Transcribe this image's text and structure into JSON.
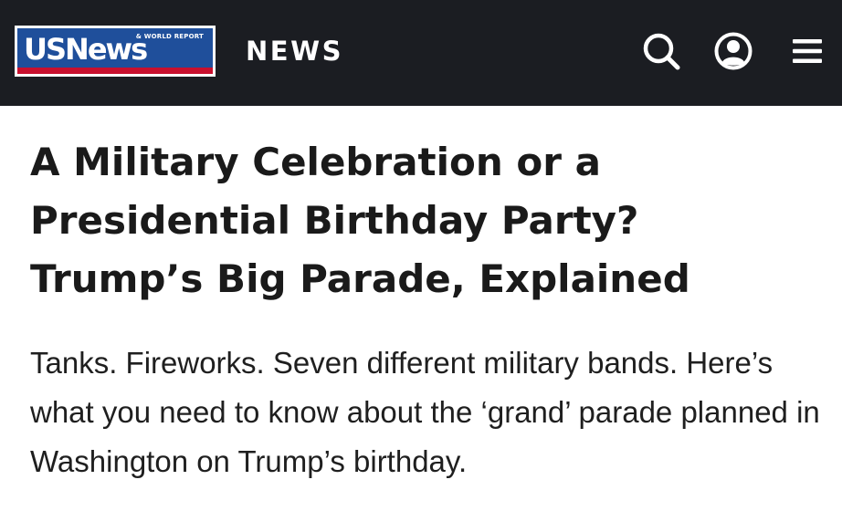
{
  "header": {
    "logo": {
      "wordmark": "USNews",
      "subtext": "& WORLD REPORT"
    },
    "section_label": "NEWS",
    "icons": {
      "search": "search-icon",
      "account": "user-account-icon",
      "menu": "hamburger-menu-icon"
    },
    "colors": {
      "background": "#1b1d22",
      "logo_blue": "#1f4f9b",
      "logo_red": "#c8102e"
    }
  },
  "article": {
    "headline": "A Military Celebration or a Presidential Birthday Party? Trump’s Big Parade, Explained",
    "dek": "Tanks. Fireworks. Seven different military bands. Here’s what you need to know about the ‘grand’ parade planned in Washington on Trump’s birthday."
  }
}
